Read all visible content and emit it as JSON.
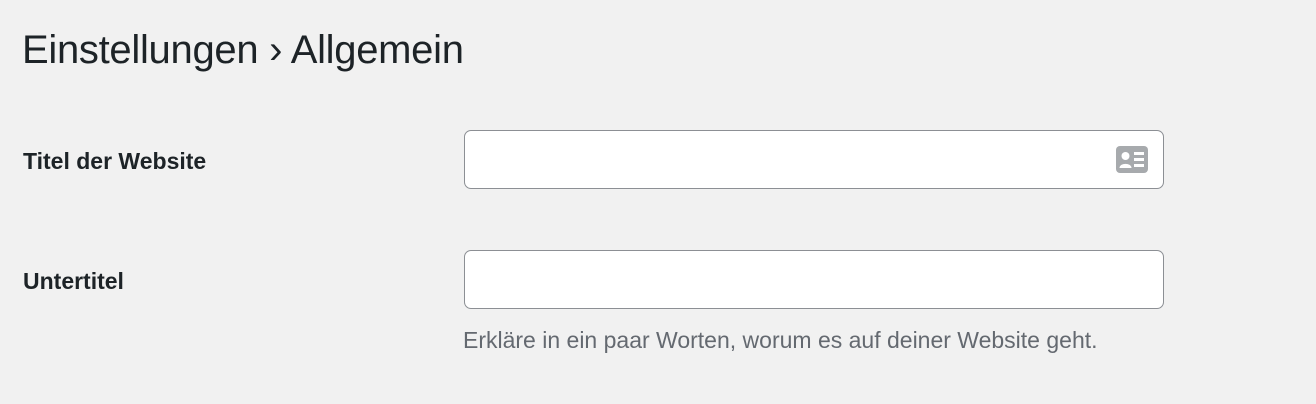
{
  "page": {
    "title": "Einstellungen › Allgemein"
  },
  "form": {
    "site_title": {
      "label": "Titel der Website",
      "value": "",
      "autofill_icon": "contact-card-icon"
    },
    "tagline": {
      "label": "Untertitel",
      "value": "",
      "description": "Erkläre in ein paar Worten, worum es auf deiner Website geht."
    }
  },
  "colors": {
    "background": "#f1f1f1",
    "input_border": "#8c8f94",
    "text": "#1d2327",
    "description_text": "#646970",
    "icon": "#a7aaad"
  }
}
